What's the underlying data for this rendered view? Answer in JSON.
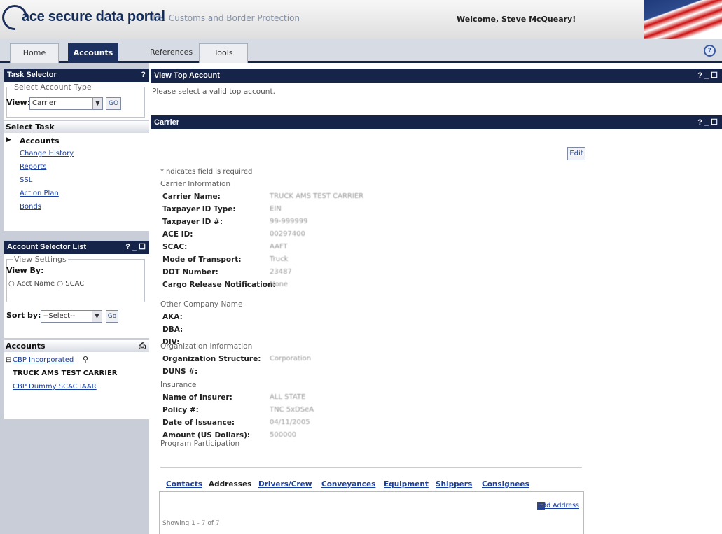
{
  "header": {
    "app_name": "ace secure data portal",
    "agency": "U.S. Customs and Border Protection",
    "welcome": "Welcome, Steve McQueary!"
  },
  "nav": {
    "tabs": [
      {
        "label": "Home",
        "active": false
      },
      {
        "label": "Accounts",
        "active": true
      },
      {
        "label": "References",
        "active": false
      },
      {
        "label": "Tools",
        "active": false
      }
    ],
    "help_icon": "?"
  },
  "task_selector": {
    "title": "Task Selector",
    "help": "?",
    "legend": "Select Account Type",
    "view_label": "View:",
    "view_value": "Carrier",
    "go_label": "GO"
  },
  "select_task": {
    "title": "Select Task",
    "items": [
      {
        "label": "Accounts",
        "current": true
      },
      {
        "label": "Change History"
      },
      {
        "label": "Reports"
      },
      {
        "label": "SSL"
      },
      {
        "label": "Action Plan"
      },
      {
        "label": "Bonds"
      }
    ]
  },
  "account_selector": {
    "title": "Account Selector List",
    "controls": "? _ ☐",
    "legend": "View Settings",
    "view_by_label": "View By:",
    "radio_acct_name": "Acct Name",
    "radio_scac": "SCAC",
    "sort_label": "Sort by:",
    "sort_value": "--Select--",
    "go_label": "Go"
  },
  "accounts": {
    "title": "Accounts",
    "items": [
      {
        "label": "CBP Incorporated",
        "type": "link",
        "prefix": "⊟"
      },
      {
        "label": "TRUCK AMS TEST CARRIER",
        "type": "bold"
      },
      {
        "label": "CBP Dummy SCAC IAAR",
        "type": "link"
      }
    ]
  },
  "view_top_account": {
    "title": "View Top Account",
    "controls": "? _ ☐",
    "message": "Please select a valid top account."
  },
  "carrier": {
    "title": "Carrier",
    "controls": "? _ ☐",
    "edit_label": "Edit",
    "required_note": "*Indicates field is required",
    "sections": [
      {
        "heading": "Carrier Information",
        "fields": [
          {
            "label": "Carrier Name:",
            "value": "TRUCK AMS TEST CARRIER"
          },
          {
            "label": "Taxpayer ID Type:",
            "value": "EIN"
          },
          {
            "label": "Taxpayer ID #:",
            "value": "99-999999"
          },
          {
            "label": "ACE ID:",
            "value": "00297400"
          },
          {
            "label": "SCAC:",
            "value": "AAFT"
          },
          {
            "label": "Mode of Transport:",
            "value": "Truck"
          },
          {
            "label": "DOT Number:",
            "value": "23487"
          },
          {
            "label": "Cargo Release Notification:",
            "value": "None"
          }
        ]
      },
      {
        "heading": "Other Company Name",
        "fields": [
          {
            "label": "AKA:",
            "value": ""
          },
          {
            "label": "DBA:",
            "value": ""
          },
          {
            "label": "DIV:",
            "value": ""
          }
        ]
      },
      {
        "heading": "Organization Information",
        "fields": [
          {
            "label": "Organization Structure:",
            "value": "Corporation"
          },
          {
            "label": "DUNS #:",
            "value": ""
          }
        ]
      },
      {
        "heading": "Insurance",
        "fields": [
          {
            "label": "Name of Insurer:",
            "value": "ALL STATE"
          },
          {
            "label": "Policy #:",
            "value": "TNC 5xDSeA"
          },
          {
            "label": "Date of Issuance:",
            "value": "04/11/2005"
          },
          {
            "label": "Amount (US Dollars):",
            "value": "500000"
          }
        ]
      },
      {
        "heading": "Program Participation",
        "fields": []
      }
    ],
    "subtabs": [
      {
        "label": "Contacts",
        "active": false
      },
      {
        "label": "Addresses",
        "active": true
      },
      {
        "label": "Drivers/Crew",
        "active": false
      },
      {
        "label": "Conveyances",
        "active": false
      },
      {
        "label": "Equipment",
        "active": false
      },
      {
        "label": "Shippers",
        "active": false
      },
      {
        "label": "Consignees",
        "active": false
      }
    ],
    "add_address_label": "Add Address",
    "showing": "Showing 1 - 7 of 7"
  }
}
